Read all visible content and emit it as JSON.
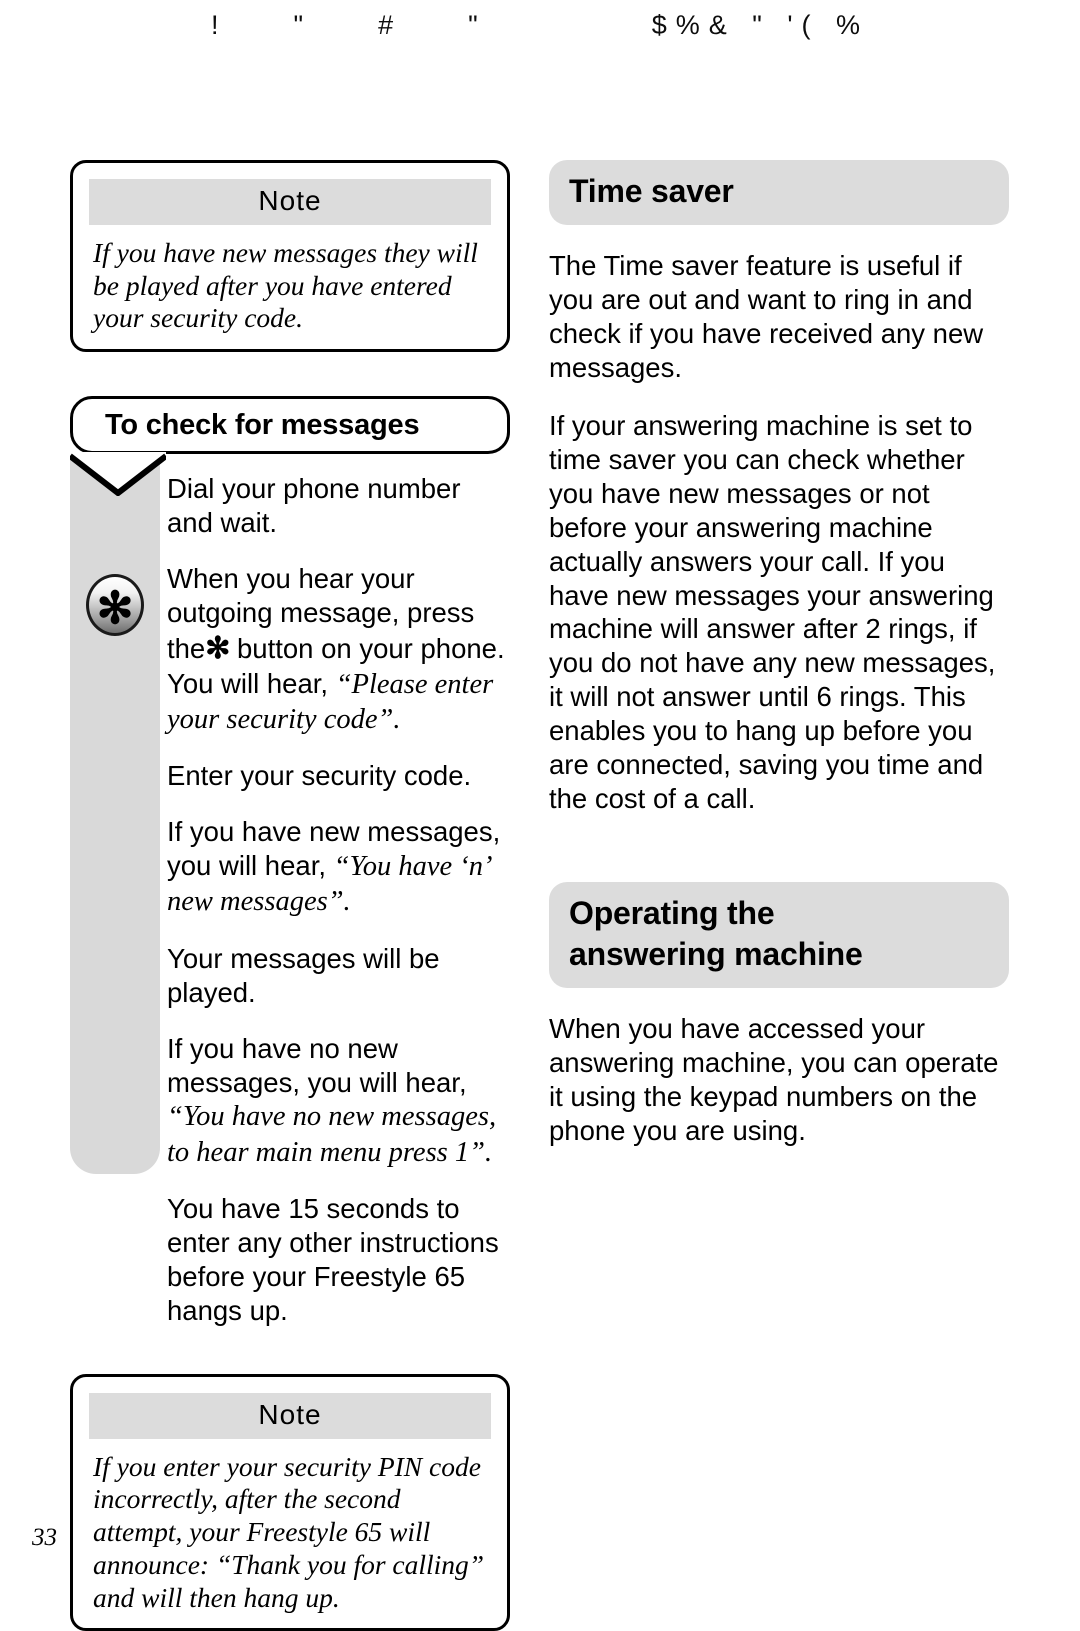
{
  "header": {
    "garbled_text": "!    \"    #    \"          $%& \" '( %"
  },
  "left_column": {
    "note_top": {
      "title": "Note",
      "body": "If you have new messages they will be played after you have entered your security code."
    },
    "callout": {
      "title": "To check for messages"
    },
    "star_button": {
      "glyph": "✻"
    },
    "steps": [
      {
        "plain_1": "Dial your phone number and wait.",
        "quote": "",
        "plain_2": ""
      },
      {
        "plain_1": "When you hear your outgoing message, press the",
        "star": "✻",
        "plain_mid": " button on your phone. You will hear, ",
        "quote": "“Please enter your security code”."
      },
      {
        "plain_1": "Enter your security code."
      },
      {
        "plain_1": "If you have new messages, you will hear, ",
        "quote": "“You have ‘n’ new messages”."
      },
      {
        "plain_1": "Your messages will be played."
      },
      {
        "plain_1": "If you have no new messages, you will hear, ",
        "quote": "“You have no new messages, to hear main menu press 1”."
      },
      {
        "plain_1": "You have 15 seconds to enter any other instructions before your Freestyle 65 hangs up."
      }
    ],
    "note_bottom": {
      "title": "Note",
      "body": "If you enter your security PIN code incorrectly, after the second attempt, your Freestyle 65 will announce: “Thank you for calling”  and will then hang up."
    }
  },
  "right_column": {
    "section_1": {
      "heading": "Time saver",
      "paragraphs": [
        "The Time saver feature is useful if you are out and want to ring in and check if you have received any new messages.",
        "If your answering machine is set to time saver you can check whether you have new messages or not before your answering machine actually answers your call. If you have new messages your answering machine will answer after 2 rings, if you do not have any new messages, it will not answer until 6 rings. This enables you to hang up before you are connected, saving you time and the cost of a call."
      ]
    },
    "section_2": {
      "heading": "Operating the\nanswering machine",
      "paragraphs": [
        "When you have accessed your answering machine, you can operate it using the keypad numbers on the phone you are using."
      ]
    }
  },
  "footer": {
    "page_number": "33"
  },
  "colors": {
    "grey_band": "#dcdcdc",
    "grey_bar": "#d9d9d9",
    "ink": "#000000",
    "paper": "#ffffff"
  }
}
